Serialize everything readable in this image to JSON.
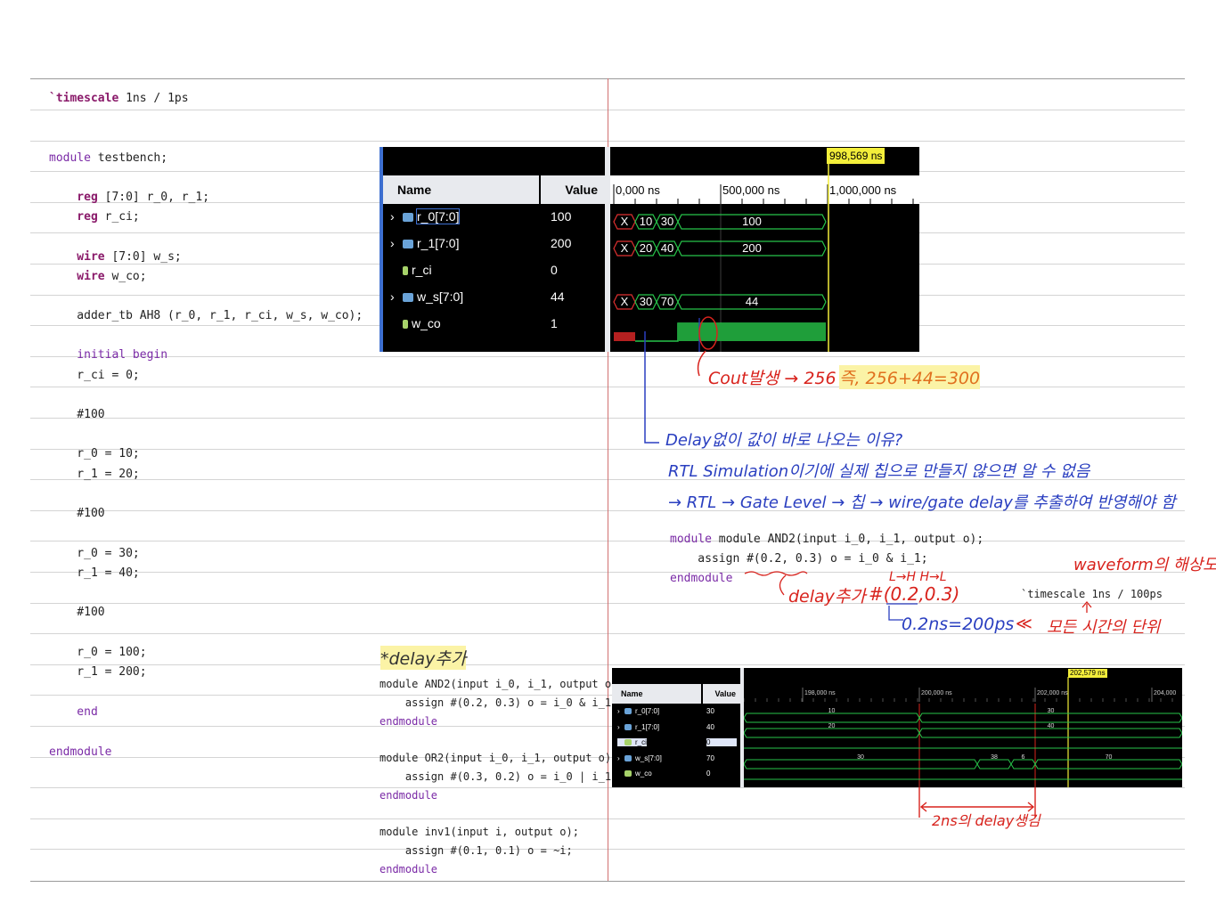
{
  "left_code": [
    {
      "parts": [
        [
          "`timescale",
          "kw-bold"
        ],
        [
          " 1ns / 1ps",
          ""
        ]
      ]
    },
    {
      "parts": [
        [
          "module",
          "kw"
        ],
        [
          " testbench;",
          ""
        ]
      ]
    },
    {
      "parts": [
        [
          "    reg",
          "kw-bold"
        ],
        [
          " [7:0] r_0, r_1;",
          ""
        ]
      ]
    },
    {
      "parts": [
        [
          "    reg",
          "kw-bold"
        ],
        [
          " r_ci;",
          ""
        ]
      ]
    },
    {
      "parts": [
        [
          "    wire",
          "kw-bold"
        ],
        [
          " [7:0] w_s;",
          ""
        ]
      ]
    },
    {
      "parts": [
        [
          "    wire",
          "kw-bold"
        ],
        [
          " w_co;",
          ""
        ]
      ]
    },
    {
      "parts": [
        [
          "    adder_tb AH8 (r_0, r_1, r_ci, w_s, w_co);",
          ""
        ]
      ]
    },
    {
      "parts": [
        [
          "    initial begin",
          "kw"
        ]
      ]
    },
    {
      "parts": [
        [
          "    r_ci = 0;",
          ""
        ]
      ]
    },
    {
      "parts": [
        [
          "    #100",
          ""
        ]
      ]
    },
    {
      "parts": [
        [
          "    r_0 = 10;",
          ""
        ]
      ]
    },
    {
      "parts": [
        [
          "    r_1 = 20;",
          ""
        ]
      ]
    },
    {
      "parts": [
        [
          "    #100",
          ""
        ]
      ]
    },
    {
      "parts": [
        [
          "    r_0 = 30;",
          ""
        ]
      ]
    },
    {
      "parts": [
        [
          "    r_1 = 40;",
          ""
        ]
      ]
    },
    {
      "parts": [
        [
          "    #100",
          ""
        ]
      ]
    },
    {
      "parts": [
        [
          "    r_0 = 100;",
          ""
        ]
      ]
    },
    {
      "parts": [
        [
          "    r_1 = 200;",
          ""
        ]
      ]
    },
    {
      "parts": [
        [
          "    end",
          "kw"
        ]
      ]
    },
    {
      "parts": [
        [
          "endmodule",
          "kw"
        ]
      ]
    }
  ],
  "wave1": {
    "cursor": "998,569 ns",
    "col_name": "Name",
    "col_value": "Value",
    "ticks": [
      "0,000 ns",
      "500,000 ns",
      "1,000,000 ns"
    ],
    "signals": [
      {
        "name": "r_0[7:0]",
        "value": "100",
        "segs": [
          "X",
          "10",
          "30",
          "100"
        ],
        "bus": true
      },
      {
        "name": "r_1[7:0]",
        "value": "200",
        "segs": [
          "X",
          "20",
          "40",
          "200"
        ],
        "bus": true
      },
      {
        "name": "r_ci",
        "value": "0",
        "bus": false
      },
      {
        "name": "w_s[7:0]",
        "value": "44",
        "segs": [
          "X",
          "30",
          "70",
          "44"
        ],
        "bus": true
      },
      {
        "name": "w_co",
        "value": "1",
        "bus": false
      }
    ]
  },
  "wave2": {
    "cursor": "202,579 ns",
    "col_name": "Name",
    "col_value": "Value",
    "ticks": [
      "198,000 ns",
      "200,000 ns",
      "202,000 ns",
      "204,000"
    ],
    "signals": [
      {
        "name": "r_0[7:0]",
        "value": "30",
        "segs": [
          "10",
          "30"
        ]
      },
      {
        "name": "r_1[7:0]",
        "value": "40",
        "segs": [
          "20",
          "40"
        ]
      },
      {
        "name": "r_ci",
        "value": "0"
      },
      {
        "name": "w_s[7:0]",
        "value": "70",
        "segs": [
          "30",
          "38",
          "6",
          "70"
        ]
      },
      {
        "name": "w_co",
        "value": "0"
      }
    ]
  },
  "notes": {
    "cout": "Cout발생 → 256",
    "cout_sum": "즉, 256+44=300",
    "why1": "Delay없이 값이 바로 나오는 이유?",
    "why2": "RTL Simulation이기에 실제 칩으로 만들지 않으면 알 수 없음",
    "why3": "→ RTL → Gate Level → 칩 → wire/gate delay를 추출하여 반영해야 함",
    "delay_add": "delay추가",
    "delay_code": "#(0.2,0.3)",
    "lh_hl": "L→H  H→L",
    "ps200": "0.2ns=200ps",
    "ps_arrow": "≪",
    "unit_label": "모든 시간의 단위",
    "waveform_res": "waveform의 해상도",
    "delay_title": "*delay추가",
    "two_ns": "2ns의 delay생김"
  },
  "mid_code": {
    "and2": [
      "module AND2(input i_0, i_1, output o);",
      "    assign #(0.2, 0.3) o = i_0 & i_1;",
      "endmodule"
    ],
    "timescale": "`timescale 1ns / 100ps"
  },
  "bottom_code": [
    "module AND2(input i_0, i_1, output o);",
    "    assign #(0.2, 0.3) o = i_0 & i_1;",
    "endmodule",
    "module OR2(input i_0, i_1, output o);",
    "    assign #(0.3, 0.2) o = i_0 | i_1;",
    "endmodule",
    "module inv1(input i, output o);",
    "    assign #(0.1, 0.1) o = ~i;",
    "endmodule"
  ]
}
